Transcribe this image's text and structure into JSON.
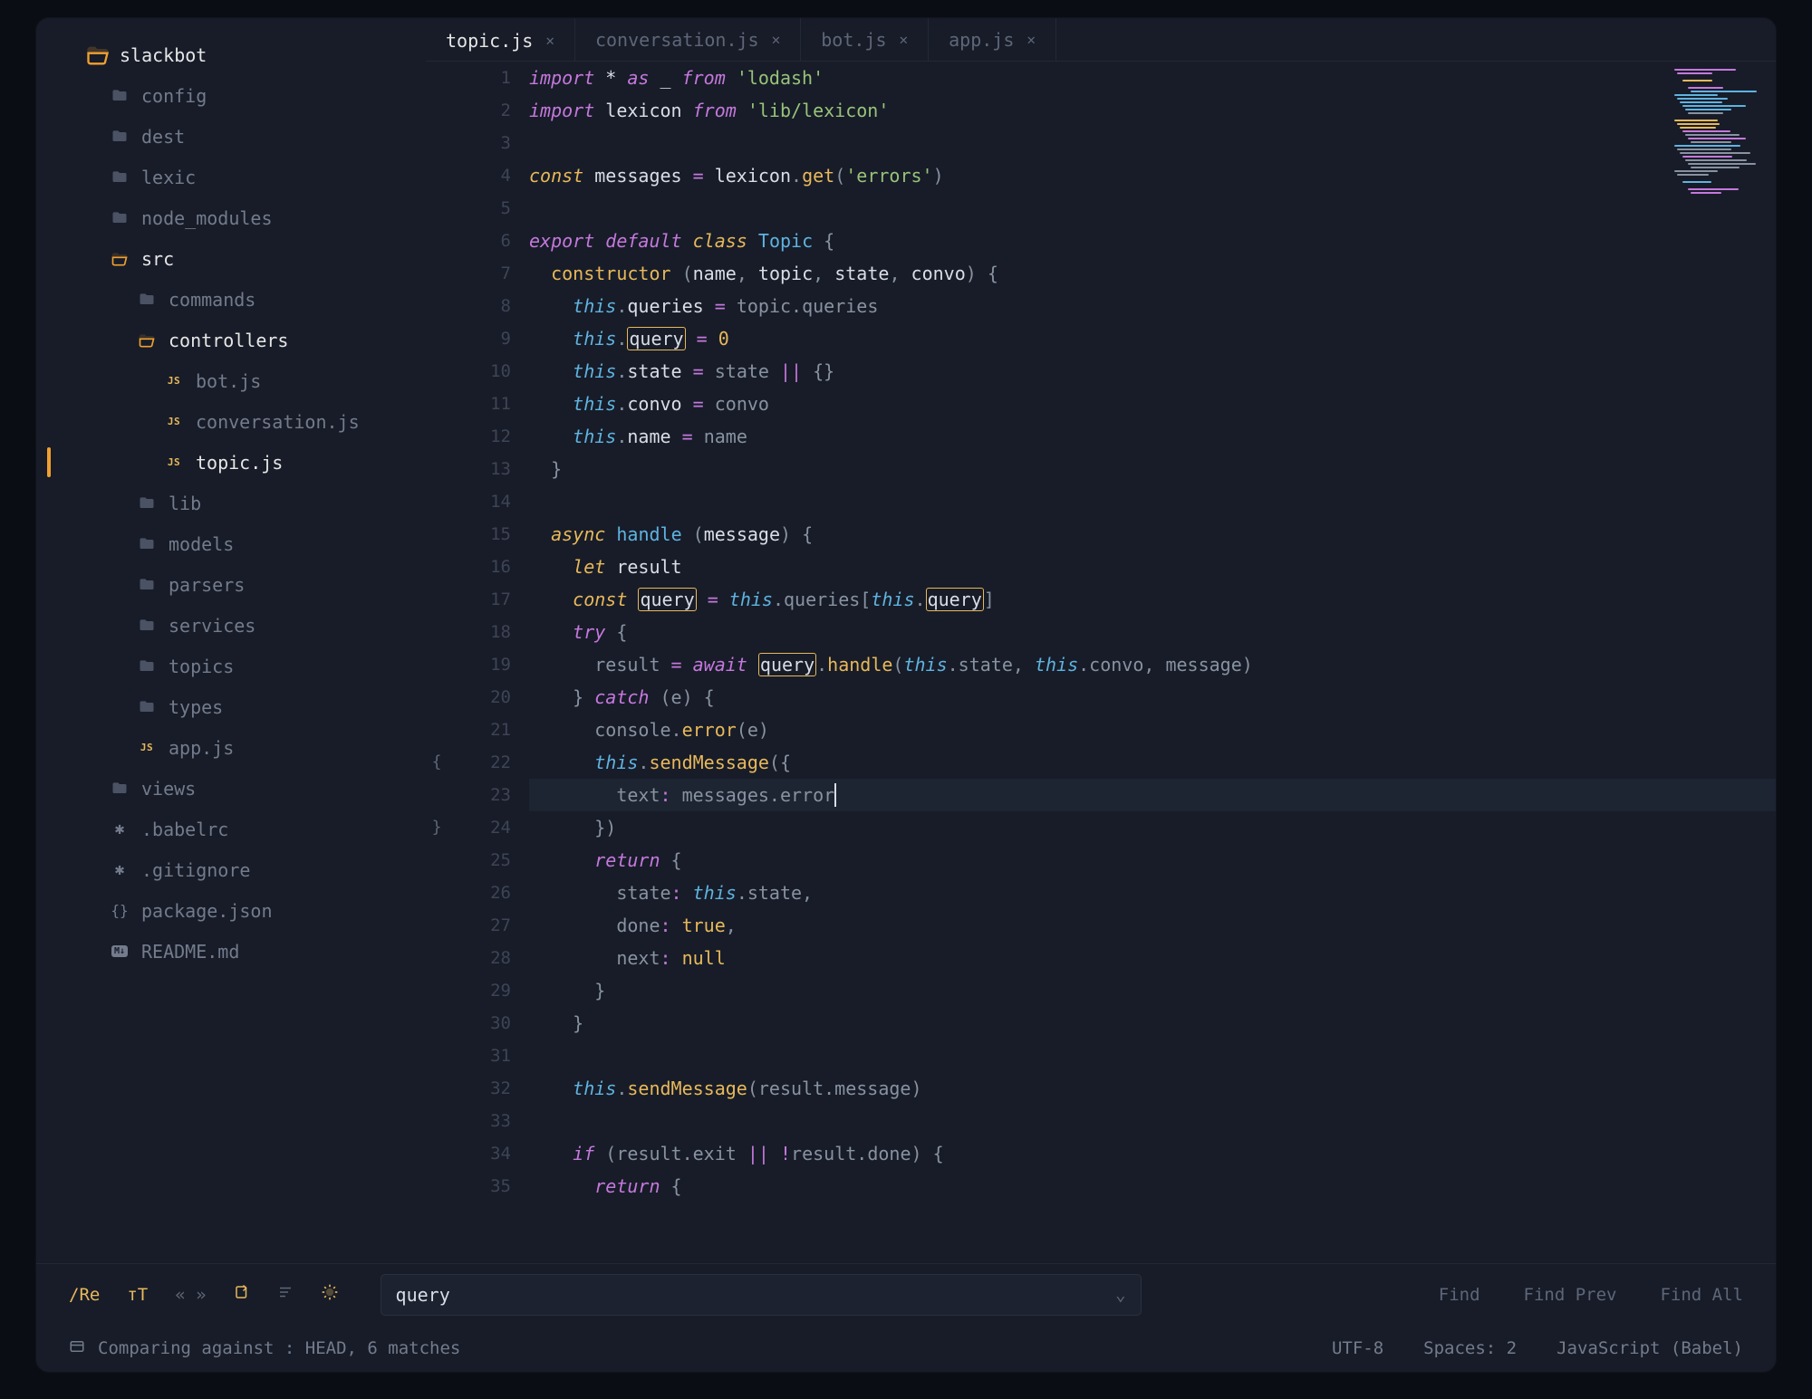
{
  "sidebar": {
    "root": "slackbot",
    "items": [
      {
        "label": "config",
        "type": "folder",
        "depth": 1
      },
      {
        "label": "dest",
        "type": "folder",
        "depth": 1
      },
      {
        "label": "lexic",
        "type": "folder",
        "depth": 1
      },
      {
        "label": "node_modules",
        "type": "folder",
        "depth": 1
      },
      {
        "label": "src",
        "type": "folder-open",
        "depth": 1,
        "hl": true
      },
      {
        "label": "commands",
        "type": "folder",
        "depth": 2
      },
      {
        "label": "controllers",
        "type": "folder-open",
        "depth": 2,
        "hl": true
      },
      {
        "label": "bot.js",
        "type": "js",
        "depth": 3
      },
      {
        "label": "conversation.js",
        "type": "js",
        "depth": 3
      },
      {
        "label": "topic.js",
        "type": "js",
        "depth": 3,
        "hl": true,
        "active": true
      },
      {
        "label": "lib",
        "type": "folder",
        "depth": 2
      },
      {
        "label": "models",
        "type": "folder",
        "depth": 2
      },
      {
        "label": "parsers",
        "type": "folder",
        "depth": 2
      },
      {
        "label": "services",
        "type": "folder",
        "depth": 2
      },
      {
        "label": "topics",
        "type": "folder",
        "depth": 2
      },
      {
        "label": "types",
        "type": "folder",
        "depth": 2
      },
      {
        "label": "app.js",
        "type": "js",
        "depth": 2
      },
      {
        "label": "views",
        "type": "folder",
        "depth": 1
      },
      {
        "label": ".babelrc",
        "type": "asterisk",
        "depth": 1
      },
      {
        "label": ".gitignore",
        "type": "asterisk",
        "depth": 1
      },
      {
        "label": "package.json",
        "type": "braces",
        "depth": 1
      },
      {
        "label": "README.md",
        "type": "md",
        "depth": 1
      }
    ]
  },
  "tabs": [
    {
      "label": "topic.js",
      "active": true
    },
    {
      "label": "conversation.js",
      "active": false
    },
    {
      "label": "bot.js",
      "active": false
    },
    {
      "label": "app.js",
      "active": false
    }
  ],
  "code": {
    "line_start": 1,
    "line_end": 35,
    "current_line": 23,
    "fold_marks": {
      "22": "{",
      "24": "}"
    },
    "lines": [
      [
        [
          "kw",
          "import"
        ],
        [
          "id",
          " * "
        ],
        [
          "kw",
          "as"
        ],
        [
          "id",
          " _ "
        ],
        [
          "kw",
          "from"
        ],
        [
          "punc",
          " "
        ],
        [
          "str",
          "'lodash'"
        ]
      ],
      [
        [
          "kw",
          "import"
        ],
        [
          "id",
          " lexicon "
        ],
        [
          "kw",
          "from"
        ],
        [
          "punc",
          " "
        ],
        [
          "str",
          "'lib/lexicon'"
        ]
      ],
      [],
      [
        [
          "kw2",
          "const"
        ],
        [
          "id",
          " messages "
        ],
        [
          "op",
          "="
        ],
        [
          "id",
          " lexicon"
        ],
        [
          "punc",
          "."
        ],
        [
          "call",
          "get"
        ],
        [
          "punc",
          "("
        ],
        [
          "str",
          "'errors'"
        ],
        [
          "punc",
          ")"
        ]
      ],
      [],
      [
        [
          "kw",
          "export"
        ],
        [
          "punc",
          " "
        ],
        [
          "kw",
          "default"
        ],
        [
          "punc",
          " "
        ],
        [
          "kw2",
          "class"
        ],
        [
          "punc",
          " "
        ],
        [
          "class",
          "Topic"
        ],
        [
          "punc",
          " {"
        ]
      ],
      [
        [
          "punc",
          "  "
        ],
        [
          "call",
          "constructor"
        ],
        [
          "punc",
          " ("
        ],
        [
          "param",
          "name"
        ],
        [
          "punc",
          ", "
        ],
        [
          "param",
          "topic"
        ],
        [
          "punc",
          ", "
        ],
        [
          "param",
          "state"
        ],
        [
          "punc",
          ", "
        ],
        [
          "param",
          "convo"
        ],
        [
          "punc",
          ") {"
        ]
      ],
      [
        [
          "punc",
          "    "
        ],
        [
          "this",
          "this"
        ],
        [
          "punc",
          "."
        ],
        [
          "prop",
          "queries"
        ],
        [
          "punc",
          " "
        ],
        [
          "op",
          "="
        ],
        [
          "punc",
          " topic.queries"
        ]
      ],
      [
        [
          "punc",
          "    "
        ],
        [
          "this",
          "this"
        ],
        [
          "punc",
          "."
        ],
        [
          "hlprop",
          "query"
        ],
        [
          "punc",
          " "
        ],
        [
          "op",
          "="
        ],
        [
          "punc",
          " "
        ],
        [
          "num",
          "0"
        ]
      ],
      [
        [
          "punc",
          "    "
        ],
        [
          "this",
          "this"
        ],
        [
          "punc",
          "."
        ],
        [
          "prop",
          "state"
        ],
        [
          "punc",
          " "
        ],
        [
          "op",
          "="
        ],
        [
          "punc",
          " state "
        ],
        [
          "op",
          "||"
        ],
        [
          "punc",
          " {}"
        ]
      ],
      [
        [
          "punc",
          "    "
        ],
        [
          "this",
          "this"
        ],
        [
          "punc",
          "."
        ],
        [
          "prop",
          "convo"
        ],
        [
          "punc",
          " "
        ],
        [
          "op",
          "="
        ],
        [
          "punc",
          " convo"
        ]
      ],
      [
        [
          "punc",
          "    "
        ],
        [
          "this",
          "this"
        ],
        [
          "punc",
          "."
        ],
        [
          "prop",
          "name"
        ],
        [
          "punc",
          " "
        ],
        [
          "op",
          "="
        ],
        [
          "punc",
          " name"
        ]
      ],
      [
        [
          "punc",
          "  }"
        ]
      ],
      [],
      [
        [
          "punc",
          "  "
        ],
        [
          "kw2",
          "async"
        ],
        [
          "punc",
          " "
        ],
        [
          "fn",
          "handle"
        ],
        [
          "punc",
          " ("
        ],
        [
          "param",
          "message"
        ],
        [
          "punc",
          ") {"
        ]
      ],
      [
        [
          "punc",
          "    "
        ],
        [
          "kw2",
          "let"
        ],
        [
          "id",
          " result"
        ]
      ],
      [
        [
          "punc",
          "    "
        ],
        [
          "kw2",
          "const"
        ],
        [
          "punc",
          " "
        ],
        [
          "hlid",
          "query"
        ],
        [
          "punc",
          " "
        ],
        [
          "op",
          "="
        ],
        [
          "punc",
          " "
        ],
        [
          "this",
          "this"
        ],
        [
          "punc",
          ".queries["
        ],
        [
          "this",
          "this"
        ],
        [
          "punc",
          "."
        ],
        [
          "hlprop",
          "query"
        ],
        [
          "punc",
          "]"
        ]
      ],
      [
        [
          "punc",
          "    "
        ],
        [
          "kw",
          "try"
        ],
        [
          "punc",
          " {"
        ]
      ],
      [
        [
          "punc",
          "      result "
        ],
        [
          "op",
          "="
        ],
        [
          "punc",
          " "
        ],
        [
          "kw",
          "await"
        ],
        [
          "punc",
          " "
        ],
        [
          "hlid",
          "query"
        ],
        [
          "punc",
          "."
        ],
        [
          "call",
          "handle"
        ],
        [
          "punc",
          "("
        ],
        [
          "this",
          "this"
        ],
        [
          "punc",
          ".state, "
        ],
        [
          "this",
          "this"
        ],
        [
          "punc",
          ".convo, message)"
        ]
      ],
      [
        [
          "punc",
          "    } "
        ],
        [
          "kw",
          "catch"
        ],
        [
          "punc",
          " (e) {"
        ]
      ],
      [
        [
          "punc",
          "      console."
        ],
        [
          "call",
          "error"
        ],
        [
          "punc",
          "(e)"
        ]
      ],
      [
        [
          "punc",
          "      "
        ],
        [
          "this",
          "this"
        ],
        [
          "punc",
          "."
        ],
        [
          "call",
          "sendMessage"
        ],
        [
          "punc",
          "({"
        ]
      ],
      [
        [
          "punc",
          "        text"
        ],
        [
          "op",
          ":"
        ],
        [
          "punc",
          " messages.error"
        ]
      ],
      [
        [
          "punc",
          "      })"
        ]
      ],
      [
        [
          "punc",
          "      "
        ],
        [
          "kw",
          "return"
        ],
        [
          "punc",
          " {"
        ]
      ],
      [
        [
          "punc",
          "        state"
        ],
        [
          "op",
          ":"
        ],
        [
          "punc",
          " "
        ],
        [
          "this",
          "this"
        ],
        [
          "punc",
          ".state,"
        ]
      ],
      [
        [
          "punc",
          "        done"
        ],
        [
          "op",
          ":"
        ],
        [
          "punc",
          " "
        ],
        [
          "bool",
          "true"
        ],
        [
          "punc",
          ","
        ]
      ],
      [
        [
          "punc",
          "        next"
        ],
        [
          "op",
          ":"
        ],
        [
          "punc",
          " "
        ],
        [
          "bool",
          "null"
        ]
      ],
      [
        [
          "punc",
          "      }"
        ]
      ],
      [
        [
          "punc",
          "    }"
        ]
      ],
      [],
      [
        [
          "punc",
          "    "
        ],
        [
          "this",
          "this"
        ],
        [
          "punc",
          "."
        ],
        [
          "call",
          "sendMessage"
        ],
        [
          "punc",
          "(result.message)"
        ]
      ],
      [],
      [
        [
          "punc",
          "    "
        ],
        [
          "kw",
          "if"
        ],
        [
          "punc",
          " (result.exit "
        ],
        [
          "op",
          "||"
        ],
        [
          "punc",
          " "
        ],
        [
          "op",
          "!"
        ],
        [
          "punc",
          "result.done) {"
        ]
      ],
      [
        [
          "punc",
          "      "
        ],
        [
          "kw",
          "return"
        ],
        [
          "punc",
          " {"
        ]
      ]
    ]
  },
  "find": {
    "regex_label": "/Re",
    "case_label": "тT",
    "value": "query",
    "buttons": [
      "Find",
      "Find Prev",
      "Find All"
    ]
  },
  "status": {
    "left": "Comparing against : HEAD, 6 matches",
    "encoding": "UTF-8",
    "indent": "Spaces: 2",
    "lang": "JavaScript (Babel)"
  }
}
